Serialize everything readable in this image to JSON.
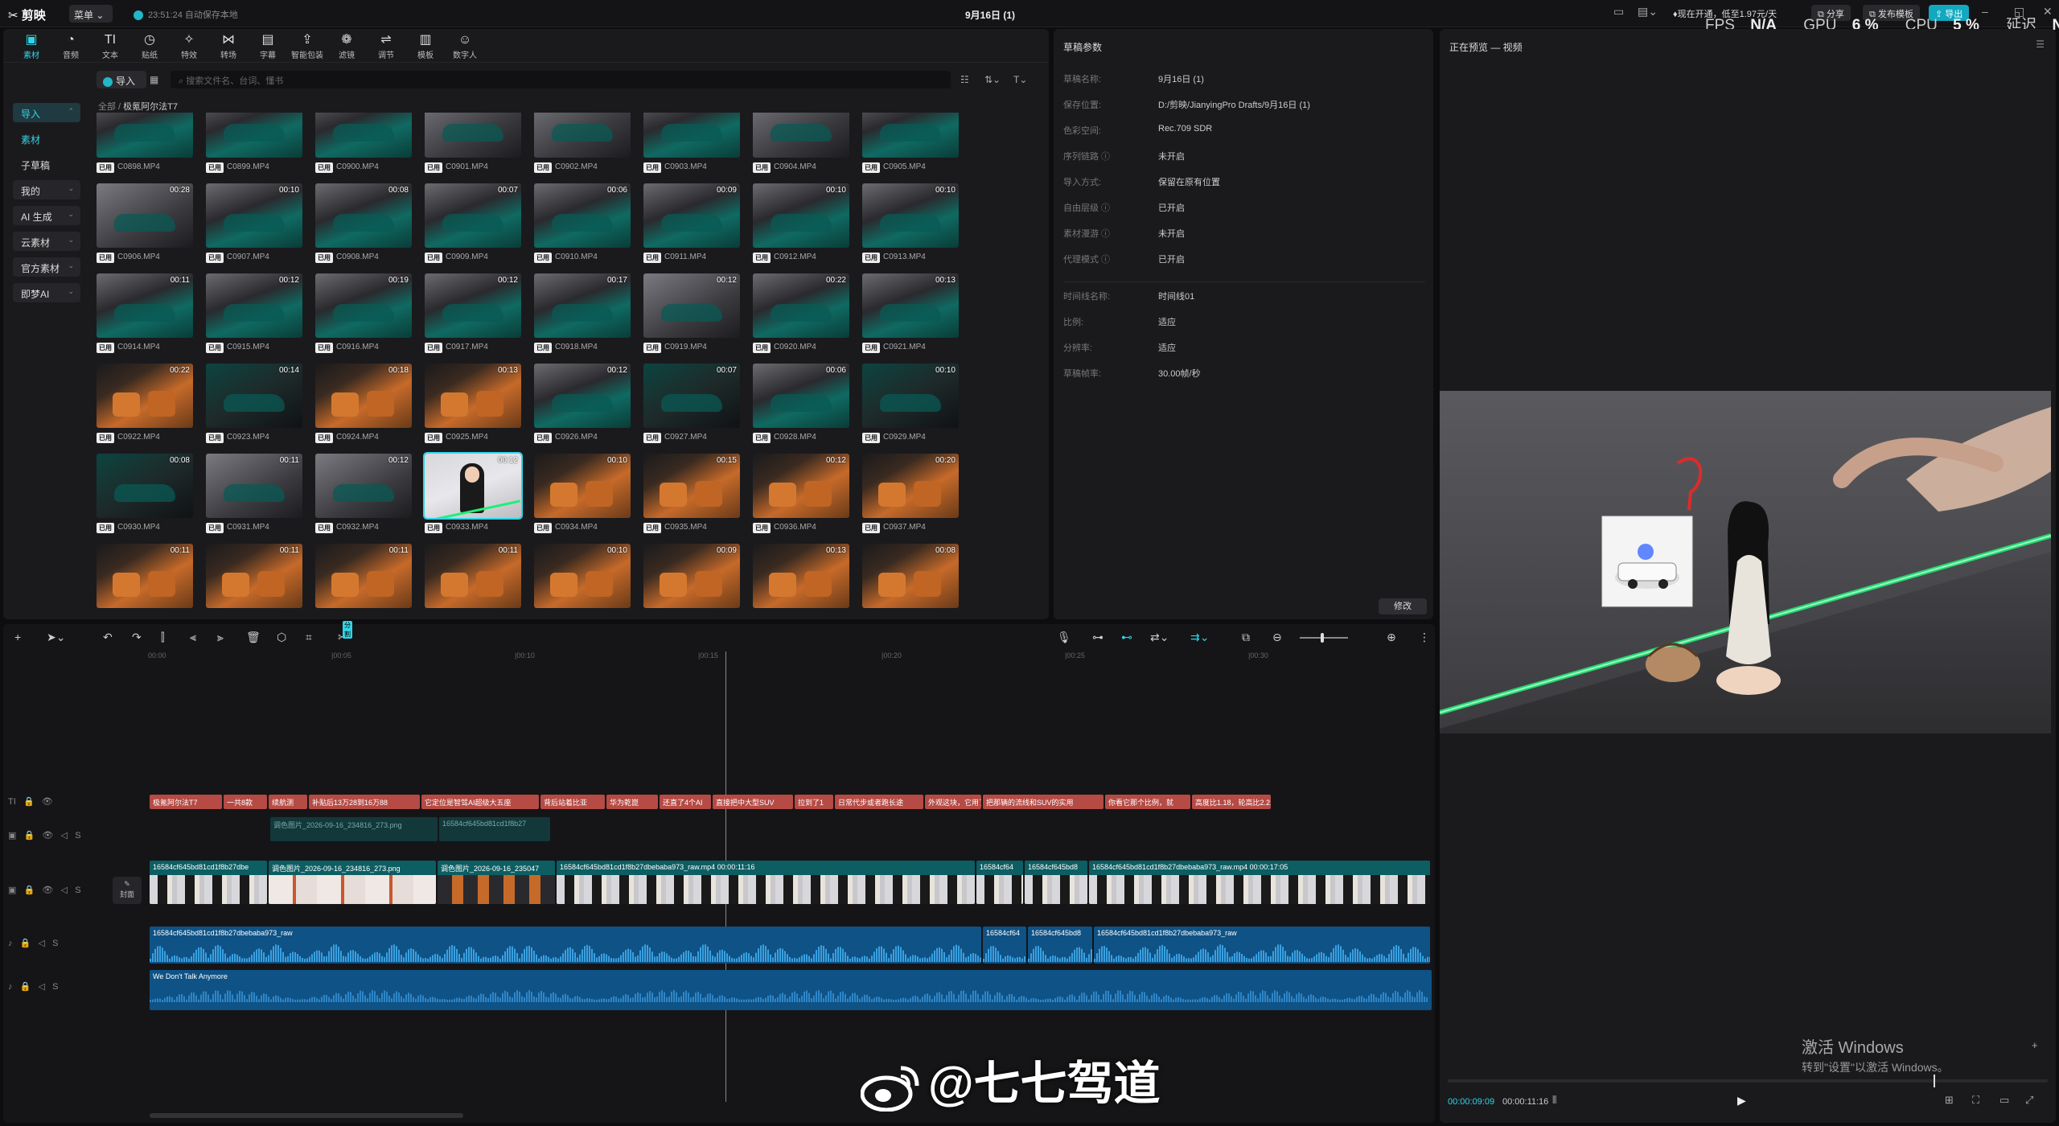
{
  "app": {
    "name": "剪映",
    "menu": "菜单",
    "autosave": "23:51:24 自动保存本地",
    "project_title": "9月16日 (1)"
  },
  "header": {
    "promo": "现在开通，低至1.97元/天",
    "share": "分享",
    "publish": "发布模板",
    "export": "导出",
    "stats": {
      "fps_label": "FPS",
      "fps": "N/A",
      "gpu_label": "GPU",
      "gpu": "6 %",
      "cpu_label": "CPU",
      "cpu": "5 %",
      "lat_label": "延迟",
      "lat": "N/A"
    }
  },
  "toolbar": [
    {
      "label": "素材",
      "icon": "media-icon",
      "glyph": "▣",
      "active": true
    },
    {
      "label": "音频",
      "icon": "audio-icon",
      "glyph": "◔"
    },
    {
      "label": "文本",
      "icon": "text-icon",
      "glyph": "TI"
    },
    {
      "label": "贴纸",
      "icon": "sticker-icon",
      "glyph": "◷"
    },
    {
      "label": "特效",
      "icon": "effects-icon",
      "glyph": "✧"
    },
    {
      "label": "转场",
      "icon": "transition-icon",
      "glyph": "⋈"
    },
    {
      "label": "字幕",
      "icon": "subtitle-icon",
      "glyph": "▤"
    },
    {
      "label": "智能包装",
      "icon": "smart-pack-icon",
      "glyph": "⇪"
    },
    {
      "label": "滤镜",
      "icon": "filter-icon",
      "glyph": "❁"
    },
    {
      "label": "调节",
      "icon": "adjust-icon",
      "glyph": "⇌"
    },
    {
      "label": "模板",
      "icon": "template-icon",
      "glyph": "▥"
    },
    {
      "label": "数字人",
      "icon": "avatar-icon",
      "glyph": "☺"
    }
  ],
  "sidebar": [
    {
      "label": "导入",
      "type": "active",
      "chev": "⌃"
    },
    {
      "label": "素材",
      "type": "sub"
    },
    {
      "label": "子草稿",
      "type": "plain"
    },
    {
      "label": "我的",
      "type": "cat",
      "chev": "⌄"
    },
    {
      "label": "AI 生成",
      "type": "cat",
      "chev": "⌄"
    },
    {
      "label": "云素材",
      "type": "cat",
      "chev": "⌄"
    },
    {
      "label": "官方素材",
      "type": "cat",
      "chev": "⌄"
    },
    {
      "label": "即梦AI",
      "type": "cat",
      "chev": "⌄"
    }
  ],
  "media": {
    "import_label": "导入",
    "search_placeholder": "搜索文件名、台词、懂书",
    "breadcrumb_root": "全部",
    "breadcrumb_folder": "极氪阿尔法T7",
    "badge": "已用",
    "thumbs": [
      {
        "name": "C0898.MP4",
        "dur": "",
        "tone": "teal"
      },
      {
        "name": "C0899.MP4",
        "dur": "",
        "tone": "teal"
      },
      {
        "name": "C0900.MP4",
        "dur": "",
        "tone": "teal"
      },
      {
        "name": "C0901.MP4",
        "dur": "",
        "tone": "grey"
      },
      {
        "name": "C0902.MP4",
        "dur": "",
        "tone": "grey"
      },
      {
        "name": "C0903.MP4",
        "dur": "",
        "tone": "teal"
      },
      {
        "name": "C0904.MP4",
        "dur": "",
        "tone": "grey"
      },
      {
        "name": "C0905.MP4",
        "dur": "",
        "tone": "teal"
      },
      {
        "name": "C0906.MP4",
        "dur": "00:28",
        "tone": "grey"
      },
      {
        "name": "C0907.MP4",
        "dur": "00:10",
        "tone": "teal"
      },
      {
        "name": "C0908.MP4",
        "dur": "00:08",
        "tone": "teal"
      },
      {
        "name": "C0909.MP4",
        "dur": "00:07",
        "tone": "teal"
      },
      {
        "name": "C0910.MP4",
        "dur": "00:06",
        "tone": "teal"
      },
      {
        "name": "C0911.MP4",
        "dur": "00:09",
        "tone": "teal"
      },
      {
        "name": "C0912.MP4",
        "dur": "00:10",
        "tone": "teal"
      },
      {
        "name": "C0913.MP4",
        "dur": "00:10",
        "tone": "teal"
      },
      {
        "name": "C0914.MP4",
        "dur": "00:11",
        "tone": "teal"
      },
      {
        "name": "C0915.MP4",
        "dur": "00:12",
        "tone": "teal"
      },
      {
        "name": "C0916.MP4",
        "dur": "00:19",
        "tone": "teal"
      },
      {
        "name": "C0917.MP4",
        "dur": "00:12",
        "tone": "teal"
      },
      {
        "name": "C0918.MP4",
        "dur": "00:17",
        "tone": "teal"
      },
      {
        "name": "C0919.MP4",
        "dur": "00:12",
        "tone": "grey"
      },
      {
        "name": "C0920.MP4",
        "dur": "00:22",
        "tone": "teal"
      },
      {
        "name": "C0921.MP4",
        "dur": "00:13",
        "tone": "teal"
      },
      {
        "name": "C0922.MP4",
        "dur": "00:22",
        "tone": "orange"
      },
      {
        "name": "C0923.MP4",
        "dur": "00:14",
        "tone": "dark"
      },
      {
        "name": "C0924.MP4",
        "dur": "00:18",
        "tone": "orange"
      },
      {
        "name": "C0925.MP4",
        "dur": "00:13",
        "tone": "orange"
      },
      {
        "name": "C0926.MP4",
        "dur": "00:12",
        "tone": "teal"
      },
      {
        "name": "C0927.MP4",
        "dur": "00:07",
        "tone": "dark"
      },
      {
        "name": "C0928.MP4",
        "dur": "00:06",
        "tone": "teal"
      },
      {
        "name": "C0929.MP4",
        "dur": "00:10",
        "tone": "dark"
      },
      {
        "name": "C0930.MP4",
        "dur": "00:08",
        "tone": "dark"
      },
      {
        "name": "C0931.MP4",
        "dur": "00:11",
        "tone": "grey"
      },
      {
        "name": "C0932.MP4",
        "dur": "00:12",
        "tone": "grey"
      },
      {
        "name": "C0933.MP4",
        "dur": "00:12",
        "tone": "girl",
        "sel": true
      },
      {
        "name": "C0934.MP4",
        "dur": "00:10",
        "tone": "orange"
      },
      {
        "name": "C0935.MP4",
        "dur": "00:15",
        "tone": "orange"
      },
      {
        "name": "C0936.MP4",
        "dur": "00:12",
        "tone": "orange"
      },
      {
        "name": "C0937.MP4",
        "dur": "00:20",
        "tone": "orange"
      },
      {
        "name": "C0938.MP4",
        "dur": "00:11",
        "tone": "orange"
      },
      {
        "name": "C0939.MP4",
        "dur": "00:11",
        "tone": "orange"
      },
      {
        "name": "C0940.MP4",
        "dur": "00:11",
        "tone": "orange"
      },
      {
        "name": "C0941.MP4",
        "dur": "00:11",
        "tone": "orange"
      },
      {
        "name": "C0942.MP4",
        "dur": "00:10",
        "tone": "orange"
      },
      {
        "name": "C0943.MP4",
        "dur": "00:09",
        "tone": "orange"
      },
      {
        "name": "C0944.MP4",
        "dur": "00:13",
        "tone": "orange"
      },
      {
        "name": "C0945.MP4",
        "dur": "00:08",
        "tone": "orange"
      }
    ]
  },
  "props": {
    "title": "草稿参数",
    "rows": [
      {
        "label": "草稿名称:",
        "value": "9月16日 (1)"
      },
      {
        "label": "保存位置:",
        "value": "D:/剪映/JianyingPro Drafts/9月16日 (1)"
      },
      {
        "label": "色彩空间:",
        "value": "Rec.709 SDR"
      },
      {
        "label": "序列链路 ⓘ",
        "value": "未开启"
      },
      {
        "label": "导入方式:",
        "value": "保留在原有位置"
      },
      {
        "label": "自由层级 ⓘ",
        "value": "已开启"
      },
      {
        "label": "素材漫游 ⓘ",
        "value": "未开启"
      },
      {
        "label": "代理模式 ⓘ",
        "value": "已开启"
      },
      {
        "label": "时间线名称:",
        "value": "时间线01"
      },
      {
        "label": "比例:",
        "value": "适应"
      },
      {
        "label": "分辨率:",
        "value": "适应"
      },
      {
        "label": "草稿帧率:",
        "value": "30.00帧/秒"
      }
    ],
    "modify": "修改"
  },
  "preview": {
    "title": "正在预览 — 视频",
    "current": "00:00:09:09",
    "total": "00:00:11:16",
    "activate_title": "激活 Windows",
    "activate_sub": "转到\"设置\"以激活 Windows。"
  },
  "timeline": {
    "ticks": [
      "00:00",
      "|00:05",
      "|00:10",
      "|00:15",
      "|00:20",
      "|00:25",
      "|00:30"
    ],
    "cover_label": "封面",
    "text_clips": [
      "极氪阿尔法T7",
      "一共8款",
      "续航测",
      "补贴后13万28到16万88",
      "它定位是智驾AI超级大五座",
      "背后站着比亚",
      "华为乾崑",
      "还直了4个AI",
      "直接把中大型SUV",
      "拉到了1",
      "日常代步或者跑长途",
      "外观这块，它用了个很酷",
      "把那辆的流线和SUV的实用",
      "你看它那个比例，就",
      "高度比1.18，轮高比2.21"
    ],
    "overlay_clips": [
      "调色图片_2026-09-16_234816_273.png",
      "16584cf645bd81cd1f8b27"
    ],
    "video_clips": [
      "16584cf645bd81cd1f8b27dbe",
      "调色图片_2026-09-16_234816_273.png",
      "调色图片_2026-09-16_235047",
      "16584cf645bd81cd1f8b27dbebaba973_raw.mp4  00:00:11:16",
      "16584cf64",
      "16584cf645bd8",
      "16584cf645bd81cd1f8b27dbebaba973_raw.mp4  00:00:17:05"
    ],
    "audio_clips": [
      "16584cf645bd81cd1f8b27dbebaba973_raw",
      "16584cf64",
      "16584cf645bd8",
      "16584cf645bd81cd1f8b27dbebaba973_raw"
    ],
    "music_clip": "We Don't Talk Anymore",
    "tooltip": "分割"
  },
  "watermark": "@七七驾道"
}
